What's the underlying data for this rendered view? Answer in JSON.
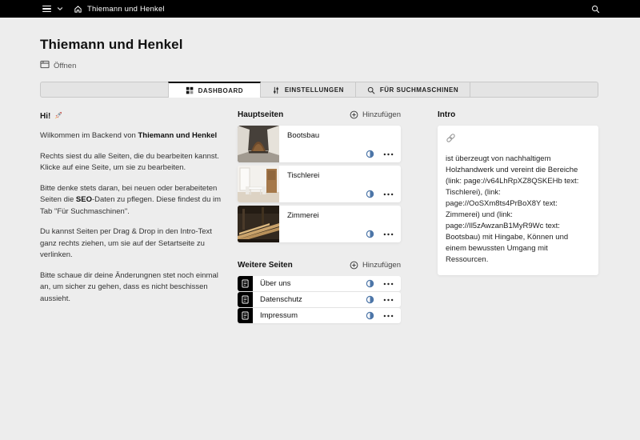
{
  "colors": {
    "topbar_bg": "#000000",
    "page_bg": "#ededed",
    "card_bg": "#ffffff",
    "status_unlisted": "#4d76a8",
    "active_tab_border": "#000000"
  },
  "topbar": {
    "site_title": "Thiemann und Henkel"
  },
  "page": {
    "title": "Thiemann und Henkel",
    "open_label": "Öffnen"
  },
  "tabs": {
    "dashboard": "Dashboard",
    "einstellungen": "Einstellungen",
    "suchmaschinen": "Für Suchmaschinen"
  },
  "welcome": {
    "greeting": "Hi!",
    "greeting_emoji": "🚀",
    "p1_prefix": "Wilkommen im Backend von ",
    "p1_bold": "Thiemann und Henkel",
    "p2": "Rechts siest du alle Seiten, die du bearbeiten kannst. Klicke auf eine Seite, um sie zu bearbeiten.",
    "p3_prefix": "Bitte denke stets daran, bei neuen oder berabeiteten Seiten die ",
    "p3_bold": "SEO",
    "p3_suffix": "-Daten zu pflegen. Diese findest du im Tab \"Für Suchmaschinen\".",
    "p4": "Du kannst Seiten per Drag & Drop in den Intro-Text ganz rechts ziehen, um sie auf der Setartseite zu verlinken.",
    "p5": "Bitte schaue dir deine Änderungnen stet noch einmal an, um sicher zu gehen, dass es nicht beschissen aussieht."
  },
  "hauptseiten": {
    "title": "Hauptseiten",
    "add_label": "Hinzufügen",
    "items": [
      {
        "title": "Bootsbau",
        "status": "unlisted"
      },
      {
        "title": "Tischlerei",
        "status": "unlisted"
      },
      {
        "title": "Zimmerei",
        "status": "unlisted"
      }
    ]
  },
  "weitere_seiten": {
    "title": "Weitere Seiten",
    "add_label": "Hinzufügen",
    "items": [
      {
        "title": "Über uns",
        "status": "unlisted"
      },
      {
        "title": "Datenschutz",
        "status": "unlisted"
      },
      {
        "title": "Impressum",
        "status": "unlisted"
      }
    ]
  },
  "intro": {
    "title": "Intro",
    "text": "ist überzeugt von nachhaltigem Holzhandwerk und vereint die Bereiche (link: page://v64LhRpXZ8QSKEHb text: Tischlerei), (link: page://OoSXm8ts4PrBoX8Y text: Zimmerei) und (link: page://Il5zAwzanB1MyR9Wc text: Bootsbau) mit Hingabe, Können und einem bewussten Umgang mit Ressourcen."
  }
}
